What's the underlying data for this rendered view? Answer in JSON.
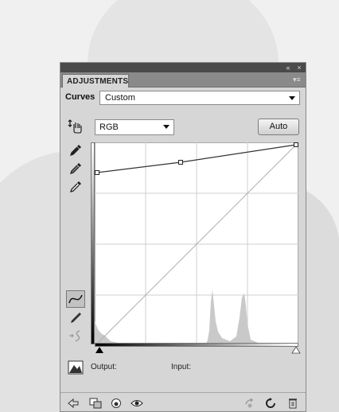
{
  "panel": {
    "tab_label": "ADJUSTMENTS",
    "adjustment_name": "Curves",
    "preset_value": "Custom",
    "channel_value": "RGB",
    "auto_label": "Auto",
    "output_label": "Output:",
    "input_label": "Input:"
  },
  "icons": {
    "collapse": "double-chevron-left-icon",
    "close": "close-icon",
    "menu": "panel-menu-icon",
    "hand": "on-image-adjust-hand-icon",
    "eyedroppers": [
      "black-point-eyedropper-icon",
      "gray-point-eyedropper-icon",
      "white-point-eyedropper-icon"
    ],
    "curve_tools": [
      "curve-point-tool-icon",
      "pencil-tool-icon",
      "smooth-curve-icon"
    ],
    "bottom": [
      "back-arrow-icon",
      "clip-to-layer-icon",
      "visibility-eye-circle-icon",
      "eye-icon",
      "view-previous-state-icon",
      "reset-icon",
      "trash-icon"
    ]
  },
  "colors": {
    "panel_bg": "#d6d6d6",
    "titlebar": "#4a4a4a",
    "tabrow": "#8a8a8a",
    "curve_line": "#333333"
  }
}
